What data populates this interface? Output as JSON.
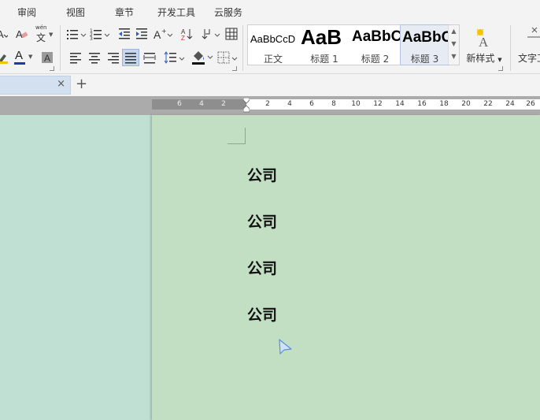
{
  "menu": {
    "tabs": [
      "审阅",
      "视图",
      "章节",
      "开发工具",
      "云服务"
    ]
  },
  "ribbon": {
    "styles": [
      {
        "sample": "AaBbCcD",
        "name": "正文"
      },
      {
        "sample": "AaB",
        "name": "标题 1"
      },
      {
        "sample": "AaBbC",
        "name": "标题 2"
      },
      {
        "sample": "AaBbC",
        "name": "标题 3"
      }
    ],
    "selected_style": "标题 3",
    "new_style_label": "新样式",
    "text_tool_label": "文字工",
    "phonetic_glyph": "文",
    "phonetic_top": "wén",
    "font_color_letter": "A",
    "accent_color": "#2e5fbf"
  },
  "tabs": {
    "close_glyph": "×",
    "new_tab_glyph": "+"
  },
  "ruler": {
    "left_numbers": [
      "6",
      "4",
      "2"
    ],
    "right_numbers": [
      "2",
      "4",
      "6",
      "8",
      "10",
      "12",
      "14",
      "16",
      "18",
      "20",
      "22",
      "24",
      "26"
    ]
  },
  "document": {
    "paragraphs": [
      "公司",
      "公司",
      "公司",
      "公司"
    ]
  }
}
